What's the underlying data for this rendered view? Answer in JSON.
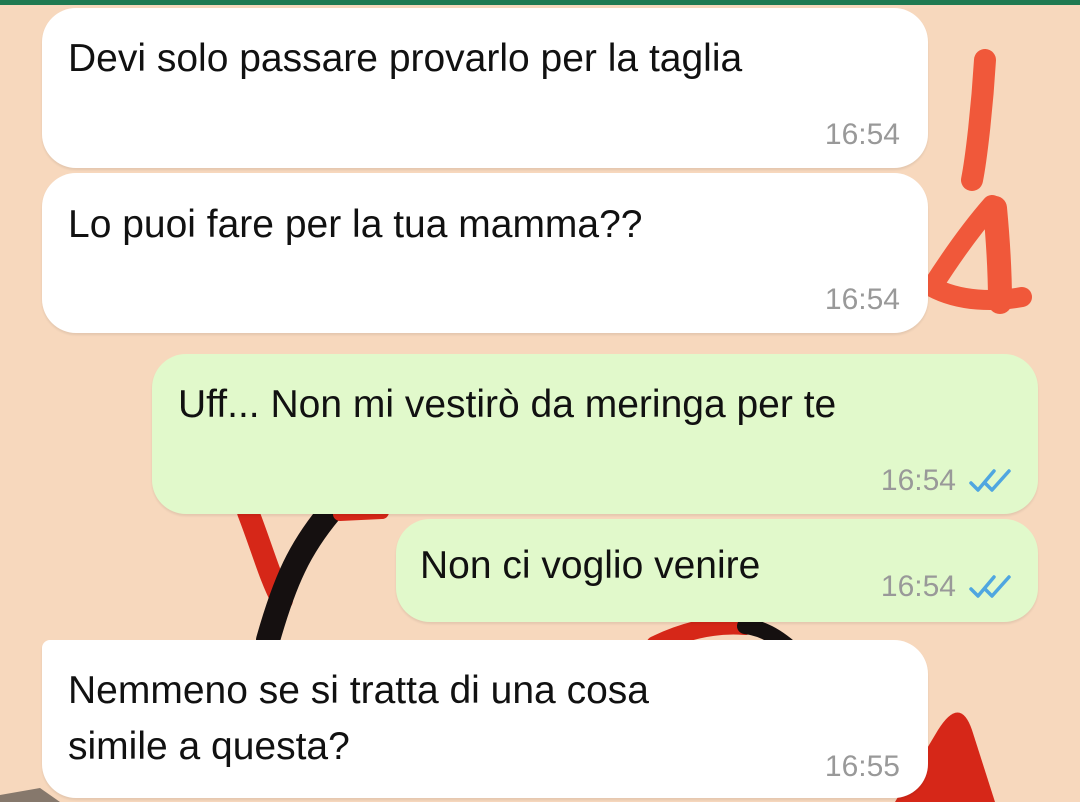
{
  "chat": {
    "messages": [
      {
        "direction": "incoming",
        "text": "Devi solo passare provarlo per la taglia",
        "time": "16:54"
      },
      {
        "direction": "incoming",
        "text": "Lo puoi fare per la tua mamma??",
        "time": "16:54"
      },
      {
        "direction": "outgoing",
        "text": "Uff... Non mi vestirò da meringa per te",
        "time": "16:54",
        "status": "read-double-check-icon"
      },
      {
        "direction": "outgoing",
        "text": "Non ci voglio venire",
        "time": "16:54",
        "status": "read-double-check-icon"
      },
      {
        "direction": "incoming",
        "lines": [
          "Nemmeno se si tratta di una cosa",
          "simile a questa?"
        ],
        "time": "16:55"
      }
    ]
  },
  "annotation": {
    "drawn_text": "14",
    "color": "#f0583a"
  },
  "colors": {
    "wallpaper": "#f7d8bd",
    "incoming_bubble": "#ffffff",
    "outgoing_bubble": "#e1f9cb",
    "read_ticks": "#4fa6e0",
    "header_strip": "#1f7a52"
  }
}
